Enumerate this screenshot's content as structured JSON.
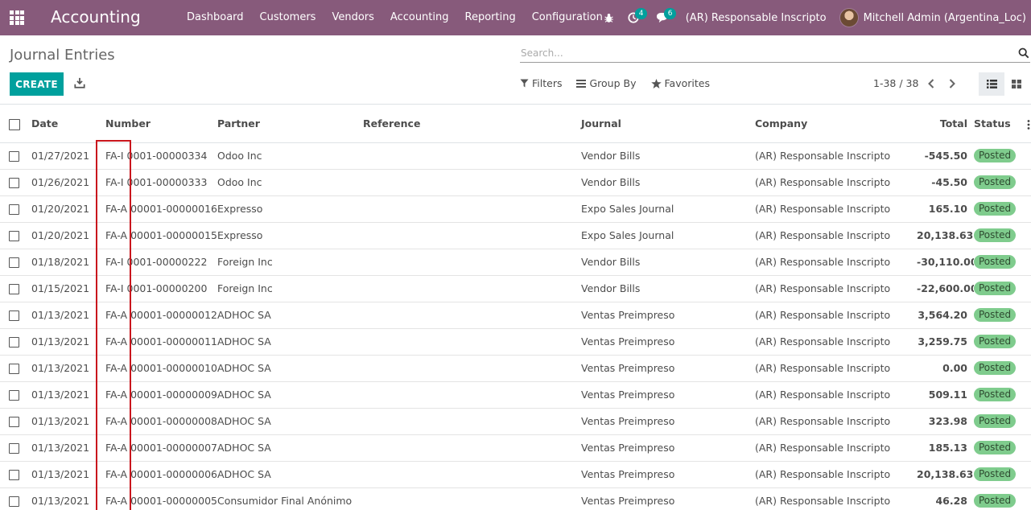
{
  "app": {
    "title": "Accounting",
    "menu": [
      "Dashboard",
      "Customers",
      "Vendors",
      "Accounting",
      "Reporting",
      "Configuration"
    ],
    "systray": {
      "activity_count": "4",
      "messages_count": "6",
      "company": "(AR) Responsable Inscripto",
      "user": "Mitchell Admin (Argentina_Loc)"
    }
  },
  "control_panel": {
    "breadcrumb": "Journal Entries",
    "search_placeholder": "Search...",
    "create_label": "CREATE",
    "filters_label": "Filters",
    "group_by_label": "Group By",
    "favorites_label": "Favorites",
    "pager": "1-38 / 38"
  },
  "table": {
    "headers": {
      "date": "Date",
      "number": "Number",
      "partner": "Partner",
      "reference": "Reference",
      "journal": "Journal",
      "company": "Company",
      "total": "Total",
      "status": "Status"
    },
    "rows": [
      {
        "date": "01/27/2021",
        "number": "FA-I 0001-00000334",
        "partner": "Odoo Inc",
        "reference": "",
        "journal": "Vendor Bills",
        "company": "(AR) Responsable Inscripto",
        "total": "-545.50",
        "status": "Posted"
      },
      {
        "date": "01/26/2021",
        "number": "FA-I 0001-00000333",
        "partner": "Odoo Inc",
        "reference": "",
        "journal": "Vendor Bills",
        "company": "(AR) Responsable Inscripto",
        "total": "-45.50",
        "status": "Posted"
      },
      {
        "date": "01/20/2021",
        "number": "FA-A 00001-00000016",
        "partner": "Expresso",
        "reference": "",
        "journal": "Expo Sales Journal",
        "company": "(AR) Responsable Inscripto",
        "total": "165.10",
        "status": "Posted"
      },
      {
        "date": "01/20/2021",
        "number": "FA-A 00001-00000015",
        "partner": "Expresso",
        "reference": "",
        "journal": "Expo Sales Journal",
        "company": "(AR) Responsable Inscripto",
        "total": "20,138.63",
        "status": "Posted"
      },
      {
        "date": "01/18/2021",
        "number": "FA-I 0001-00000222",
        "partner": "Foreign Inc",
        "reference": "",
        "journal": "Vendor Bills",
        "company": "(AR) Responsable Inscripto",
        "total": "-30,110.00",
        "status": "Posted"
      },
      {
        "date": "01/15/2021",
        "number": "FA-I 0001-00000200",
        "partner": "Foreign Inc",
        "reference": "",
        "journal": "Vendor Bills",
        "company": "(AR) Responsable Inscripto",
        "total": "-22,600.00",
        "status": "Posted"
      },
      {
        "date": "01/13/2021",
        "number": "FA-A 00001-00000012",
        "partner": "ADHOC SA",
        "reference": "",
        "journal": "Ventas Preimpreso",
        "company": "(AR) Responsable Inscripto",
        "total": "3,564.20",
        "status": "Posted"
      },
      {
        "date": "01/13/2021",
        "number": "FA-A 00001-00000011",
        "partner": "ADHOC SA",
        "reference": "",
        "journal": "Ventas Preimpreso",
        "company": "(AR) Responsable Inscripto",
        "total": "3,259.75",
        "status": "Posted"
      },
      {
        "date": "01/13/2021",
        "number": "FA-A 00001-00000010",
        "partner": "ADHOC SA",
        "reference": "",
        "journal": "Ventas Preimpreso",
        "company": "(AR) Responsable Inscripto",
        "total": "0.00",
        "status": "Posted"
      },
      {
        "date": "01/13/2021",
        "number": "FA-A 00001-00000009",
        "partner": "ADHOC SA",
        "reference": "",
        "journal": "Ventas Preimpreso",
        "company": "(AR) Responsable Inscripto",
        "total": "509.11",
        "status": "Posted"
      },
      {
        "date": "01/13/2021",
        "number": "FA-A 00001-00000008",
        "partner": "ADHOC SA",
        "reference": "",
        "journal": "Ventas Preimpreso",
        "company": "(AR) Responsable Inscripto",
        "total": "323.98",
        "status": "Posted"
      },
      {
        "date": "01/13/2021",
        "number": "FA-A 00001-00000007",
        "partner": "ADHOC SA",
        "reference": "",
        "journal": "Ventas Preimpreso",
        "company": "(AR) Responsable Inscripto",
        "total": "185.13",
        "status": "Posted"
      },
      {
        "date": "01/13/2021",
        "number": "FA-A 00001-00000006",
        "partner": "ADHOC SA",
        "reference": "",
        "journal": "Ventas Preimpreso",
        "company": "(AR) Responsable Inscripto",
        "total": "20,138.63",
        "status": "Posted"
      },
      {
        "date": "01/13/2021",
        "number": "FA-A 00001-00000005",
        "partner": "Consumidor Final Anónimo",
        "reference": "",
        "journal": "Ventas Preimpreso",
        "company": "(AR) Responsable Inscripto",
        "total": "46.28",
        "status": "Posted"
      }
    ]
  },
  "colors": {
    "navbar": "#875a7b",
    "primary": "#00a09d",
    "status_badge": "#7fcc8d",
    "highlight": "#c9161d"
  },
  "icons": {
    "apps": "apps-grid-icon",
    "bug": "bug-icon",
    "activity": "clock-icon",
    "messages": "chat-icon",
    "search": "search-icon",
    "download": "download-icon",
    "filter": "filter-icon",
    "group_by": "list-bars-icon",
    "favorites": "star-icon",
    "list_view": "list-view-icon",
    "kanban_view": "kanban-view-icon",
    "optional_columns": "vertical-dots-icon"
  }
}
